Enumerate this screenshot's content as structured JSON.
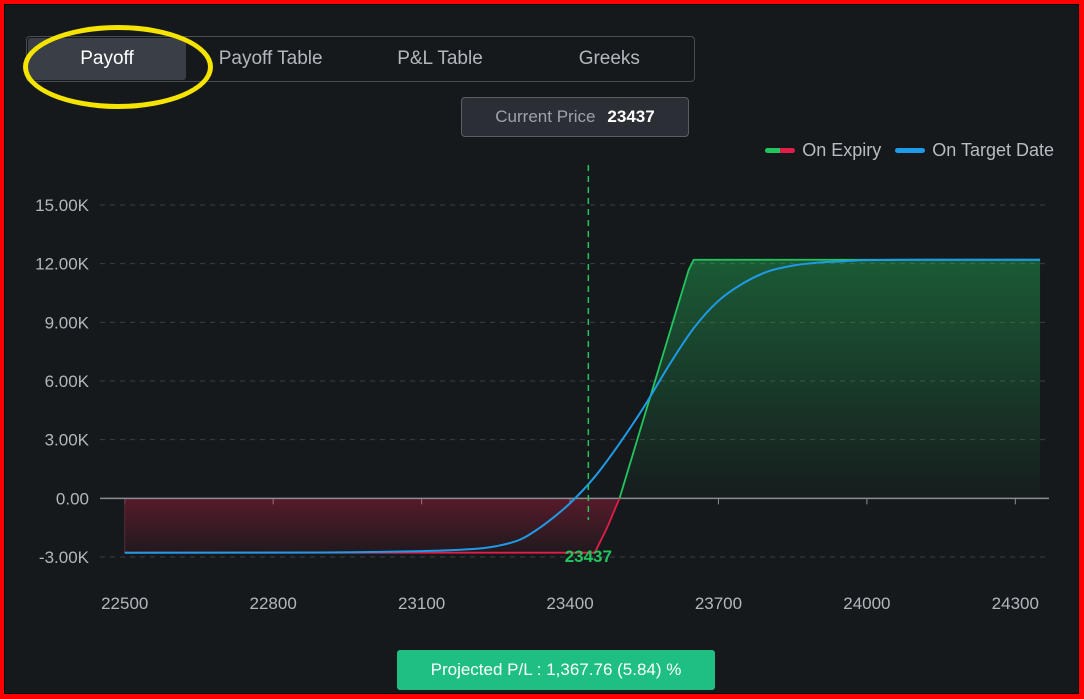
{
  "tabs": [
    {
      "label": "Payoff",
      "active": true
    },
    {
      "label": "Payoff Table",
      "active": false
    },
    {
      "label": "P&L Table",
      "active": false
    },
    {
      "label": "Greeks",
      "active": false
    }
  ],
  "current_price": {
    "label": "Current Price",
    "value": "23437"
  },
  "legend": {
    "expiry": "On Expiry",
    "target": "On Target Date"
  },
  "colors": {
    "profit": "#22c55e",
    "loss": "#e11d48",
    "target": "#1e9be8",
    "highlight": "#f5e400",
    "projected_bg": "#1fbf83"
  },
  "projected": {
    "text": "Projected P/L : 1,367.76 (5.84) %"
  },
  "chart_data": {
    "type": "line",
    "xlim": [
      22450,
      24360
    ],
    "ylim": [
      -3000,
      15000
    ],
    "x_ticks": [
      22500,
      22800,
      23100,
      23400,
      23700,
      24000,
      24300
    ],
    "x_tick_labels": [
      "22500",
      "22800",
      "23100",
      "23400",
      "23700",
      "24000",
      "24300"
    ],
    "y_ticks": [
      -3000,
      0,
      3000,
      6000,
      9000,
      12000,
      15000
    ],
    "y_tick_labels": [
      "-3.00K",
      "0.00",
      "3.00K",
      "6.00K",
      "9.00K",
      "12.00K",
      "15.00K"
    ],
    "grid": true,
    "legend_position": "top-right",
    "current_price": 23437,
    "current_price_label": "23437",
    "series": [
      {
        "name": "On Expiry",
        "x": [
          22500,
          23450,
          23475,
          23500,
          23640,
          23650,
          24350
        ],
        "y": [
          -2780,
          -2780,
          -1500,
          0,
          11700,
          12200,
          12200
        ]
      },
      {
        "name": "On Target Date",
        "x": [
          22500,
          22900,
          23100,
          23200,
          23250,
          23300,
          23350,
          23400,
          23450,
          23500,
          23550,
          23600,
          23650,
          23700,
          23750,
          23800,
          23850,
          23900,
          23950,
          24000,
          24100,
          24200,
          24350
        ],
        "y": [
          -2780,
          -2770,
          -2700,
          -2600,
          -2450,
          -2100,
          -1300,
          -250,
          1100,
          2800,
          4700,
          6800,
          8700,
          10100,
          11000,
          11600,
          11900,
          12050,
          12120,
          12180,
          12200,
          12200,
          12200
        ]
      }
    ]
  }
}
